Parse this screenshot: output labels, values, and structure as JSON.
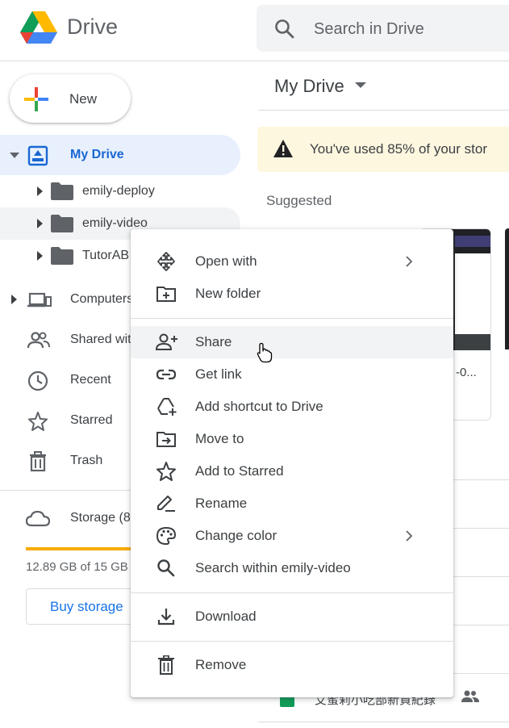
{
  "header": {
    "app_title": "Drive",
    "search_placeholder": "Search in Drive"
  },
  "sidebar": {
    "new_label": "New",
    "my_drive": "My Drive",
    "folders": [
      {
        "label": "emily-deploy"
      },
      {
        "label": "emily-video"
      },
      {
        "label": "TutorAB"
      }
    ],
    "computers": "Computers",
    "shared_with_me": "Shared wit",
    "recent": "Recent",
    "starred": "Starred",
    "trash": "Trash",
    "storage_label": "Storage (8",
    "storage_usage": "12.89 GB of 15 GB",
    "storage_fraction": 0.859,
    "buy_storage": "Buy storage"
  },
  "main": {
    "title": "My Drive",
    "warning": "You've used 85% of your stor",
    "suggested_heading": "Suggested",
    "suggested_card_title": "-0...",
    "file_row_name": "艾蜜莉小吃部新貨紀錄"
  },
  "context_menu": {
    "items": [
      {
        "label": "Open with",
        "icon": "open-with-icon",
        "submenu": true
      },
      {
        "label": "New folder",
        "icon": "new-folder-icon"
      },
      {
        "label": "Share",
        "icon": "share-person-add-icon"
      },
      {
        "label": "Get link",
        "icon": "link-icon"
      },
      {
        "label": "Add shortcut to Drive",
        "icon": "add-shortcut-icon"
      },
      {
        "label": "Move to",
        "icon": "move-to-icon"
      },
      {
        "label": "Add to Starred",
        "icon": "star-icon"
      },
      {
        "label": "Rename",
        "icon": "rename-pencil-icon"
      },
      {
        "label": "Change color",
        "icon": "palette-icon",
        "submenu": true
      },
      {
        "label": "Search within emily-video",
        "icon": "search-icon"
      },
      {
        "label": "Download",
        "icon": "download-icon"
      },
      {
        "label": "Remove",
        "icon": "trash-icon"
      }
    ]
  },
  "colors": {
    "accent": "#1a73e8",
    "active_bg": "#e8f0fe",
    "storage_fill": "#f9ab00",
    "warning_bg": "#fef7e0"
  }
}
